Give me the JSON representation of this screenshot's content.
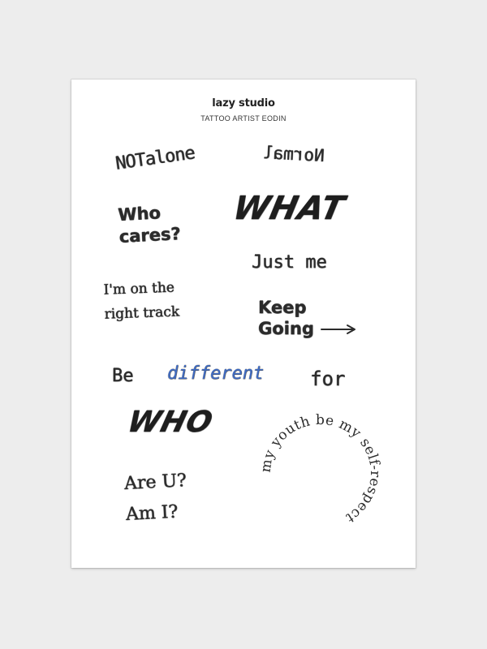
{
  "brand": {
    "title": "lazy studio",
    "subtitle": "TATTOO ARTIST EODIN"
  },
  "stickers": {
    "not_alone": "NOTalone",
    "normal": "Normal",
    "who_cares_1": "Who",
    "who_cares_2": "cares?",
    "what": "WHAT",
    "just_me": "Just me",
    "right_track_1": "I'm on the",
    "right_track_2": "right track",
    "keep_going_1": "Keep",
    "keep_going_2": "Going",
    "be": "Be",
    "different": "different",
    "for": "for",
    "who": "WHO",
    "are_u": "Are U?",
    "am_i": "Am I?",
    "circle_text": "my youth be my self-respect"
  },
  "colors": {
    "ink": "#2b2b2b",
    "accent_blue": "#3e6bc4",
    "background": "#ededed",
    "sheet": "#ffffff"
  }
}
